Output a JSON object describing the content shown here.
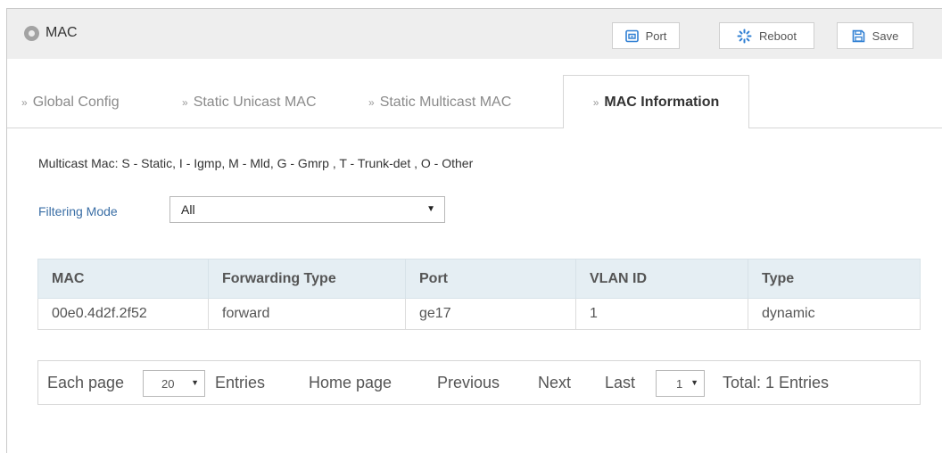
{
  "header": {
    "title": "MAC",
    "buttons": {
      "port": "Port",
      "reboot": "Reboot",
      "save": "Save"
    }
  },
  "tabs": [
    {
      "label": "Global Config",
      "active": false
    },
    {
      "label": "Static Unicast MAC",
      "active": false
    },
    {
      "label": "Static Multicast MAC",
      "active": false
    },
    {
      "label": "MAC Information",
      "active": true
    }
  ],
  "legend": "Multicast Mac: S - Static, I - Igmp, M - Mld, G - Gmrp , T - Trunk-det , O - Other",
  "filter": {
    "label": "Filtering Mode",
    "value": "All"
  },
  "table": {
    "columns": [
      "MAC",
      "Forwarding Type",
      "Port",
      "VLAN ID",
      "Type"
    ],
    "rows": [
      [
        "00e0.4d2f.2f52",
        "forward",
        "ge17",
        "1",
        "dynamic"
      ]
    ]
  },
  "pager": {
    "each_page_label": "Each page",
    "page_size": "20",
    "entries_label": "Entries",
    "home": "Home page",
    "previous": "Previous",
    "next": "Next",
    "last": "Last",
    "current_page": "1",
    "total": "Total: 1 Entries"
  },
  "colors": {
    "header_bg": "#eeeeee",
    "table_header_bg": "#e5eef3",
    "filter_label": "#3a6ea5",
    "icon_blue": "#2f7fd3"
  },
  "icons": {
    "header": "circle-icon",
    "port": "port-icon",
    "reboot": "spinner-icon",
    "save": "floppy-disk-icon",
    "tab": "double-chevron-right-icon"
  }
}
